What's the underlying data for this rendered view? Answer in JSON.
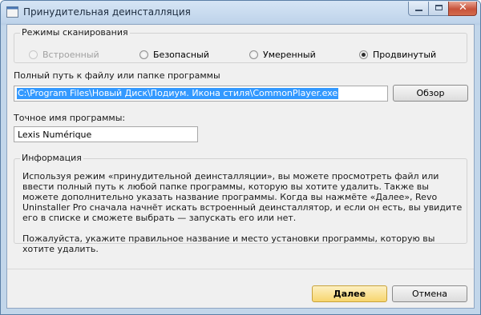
{
  "window": {
    "title": "Принудительная деинсталляция"
  },
  "scan_modes": {
    "legend": "Режимы сканирования",
    "options": [
      {
        "label": "Встроенный",
        "selected": false,
        "enabled": false
      },
      {
        "label": "Безопасный",
        "selected": false,
        "enabled": true
      },
      {
        "label": "Умеренный",
        "selected": false,
        "enabled": true
      },
      {
        "label": "Продвинутый",
        "selected": true,
        "enabled": true
      }
    ]
  },
  "path": {
    "label": "Полный путь к файлу или папке программы",
    "value": "C:\\Program Files\\Новый Диск\\Подиум. Икона стиля\\CommonPlayer.exe",
    "browse_label": "Обзор"
  },
  "program_name": {
    "label": "Точное имя программы:",
    "value": "Lexis Numérique"
  },
  "info": {
    "legend": "Информация",
    "paragraph1": "Используя режим «принудительной деинсталляции», вы можете просмотреть файл или ввести полный путь к любой папке программы, которую вы хотите удалить. Также вы можете дополнительно указать название программы. Когда вы нажмёте «Далее», Revo Uninstaller Pro сначала начнёт искать встроенный деинсталлятор, и если он есть, вы увидите его в списке и сможете выбрать — запускать его или нет.",
    "paragraph2": "Пожалуйста, укажите правильное название и место установки программы, которую вы хотите удалить."
  },
  "footer": {
    "next_label": "Далее",
    "cancel_label": "Отмена"
  },
  "colors": {
    "selection": "#3399ff",
    "default_button": "#f7d56e",
    "close_button": "#c8523a"
  }
}
